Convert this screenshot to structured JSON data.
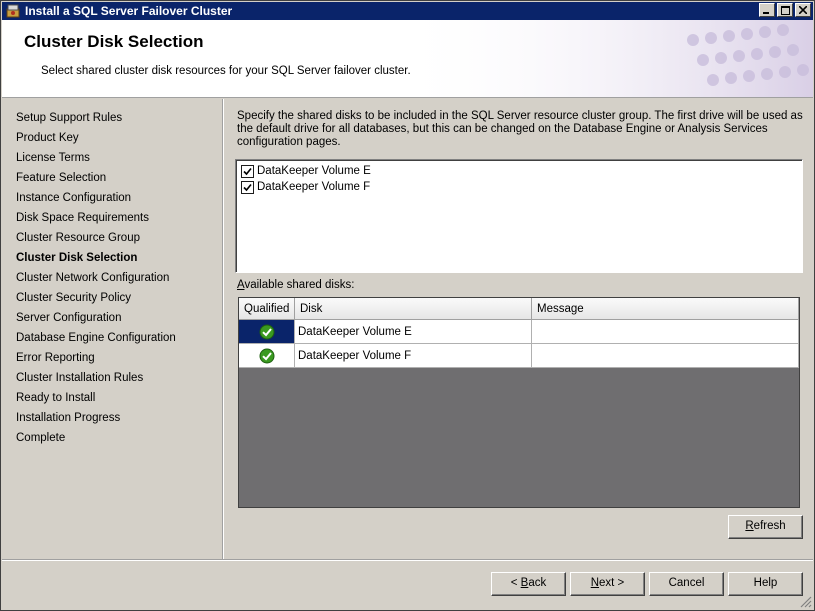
{
  "window": {
    "title": "Install a SQL Server Failover Cluster"
  },
  "header": {
    "title": "Cluster Disk Selection",
    "subtitle": "Select shared cluster disk resources for your SQL Server failover cluster."
  },
  "sidebar": {
    "items": [
      {
        "label": "Setup Support Rules"
      },
      {
        "label": "Product Key"
      },
      {
        "label": "License Terms"
      },
      {
        "label": "Feature Selection"
      },
      {
        "label": "Instance Configuration"
      },
      {
        "label": "Disk Space Requirements"
      },
      {
        "label": "Cluster Resource Group"
      },
      {
        "label": "Cluster Disk Selection"
      },
      {
        "label": "Cluster Network Configuration"
      },
      {
        "label": "Cluster Security Policy"
      },
      {
        "label": "Server Configuration"
      },
      {
        "label": "Database Engine Configuration"
      },
      {
        "label": "Error Reporting"
      },
      {
        "label": "Cluster Installation Rules"
      },
      {
        "label": "Ready to Install"
      },
      {
        "label": "Installation Progress"
      },
      {
        "label": "Complete"
      }
    ],
    "active_index": 7
  },
  "main": {
    "instructions": "Specify the shared disks to be included in the SQL Server resource cluster group. The first drive will be used as the default drive for all databases, but this can be changed on the Database Engine or Analysis Services configuration pages.",
    "disk_list": [
      {
        "label": "DataKeeper Volume E",
        "checked": true
      },
      {
        "label": "DataKeeper Volume F",
        "checked": true
      }
    ],
    "available_label_first": "A",
    "available_label_rest": "vailable shared disks:",
    "grid": {
      "columns": [
        "Qualified",
        "Disk",
        "Message"
      ],
      "rows": [
        {
          "disk": "DataKeeper Volume E",
          "message": "",
          "qualified": true
        },
        {
          "disk": "DataKeeper Volume F",
          "message": "",
          "qualified": true
        }
      ]
    },
    "refresh": {
      "key": "R",
      "rest": "efresh"
    }
  },
  "footer": {
    "back": {
      "prefix": "< ",
      "key": "B",
      "rest": "ack"
    },
    "next": {
      "key": "N",
      "rest": "ext >"
    },
    "cancel": "Cancel",
    "help": "Help"
  },
  "colors": {
    "titlebar": "#0a246a",
    "selection": "#0a246a",
    "grid_empty": "#6f6e70",
    "check_green": "#3a9a20"
  },
  "icons": {
    "app": "sql-setup-icon",
    "qualified": "green-check-icon"
  }
}
